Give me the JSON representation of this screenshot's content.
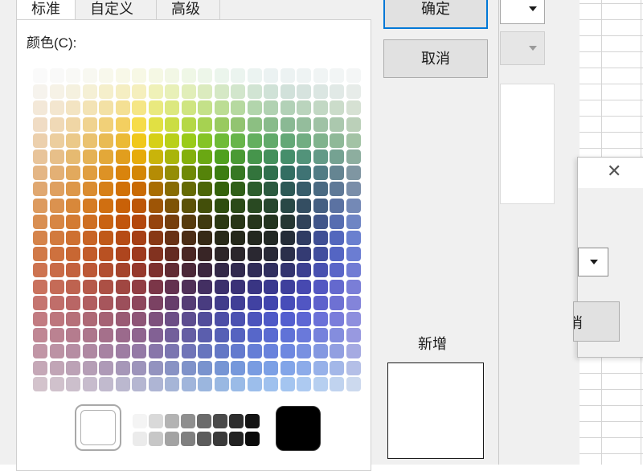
{
  "dialog": {
    "tabs": [
      {
        "label": "标准",
        "active": true
      },
      {
        "label": "自定义",
        "active": false
      },
      {
        "label": "高级",
        "active": false
      }
    ],
    "color_label": "颜色(C):",
    "ok_label": "确定",
    "cancel_label": "取消",
    "new_label": "新增",
    "current_color": "#ffffff",
    "new_color": "#ffffff"
  },
  "palette": {
    "grid_colors": [
      [
        "#fafafa",
        "#f9f9f8",
        "#f9f9f6",
        "#f8f8f1",
        "#f8f8ec",
        "#f8f8e8",
        "#f7f8e5",
        "#f5f8e4",
        "#f2f7e5",
        "#eff7e6",
        "#edf6e9",
        "#ebf5ec",
        "#ebf4ef",
        "#ebf3f1",
        "#ebf2f2",
        "#ecf2f2",
        "#eef3f3",
        "#f0f4f4",
        "#f2f5f5",
        "#f4f6f6"
      ],
      [
        "#f6f3ed",
        "#f6f2e6",
        "#f5f1df",
        "#f5f0d5",
        "#f5efcb",
        "#f5eec2",
        "#f5efbd",
        "#eff1b8",
        "#e8f0b8",
        "#e1eeb9",
        "#dbebbe",
        "#d5e8c5",
        "#d2e6cc",
        "#d1e4d3",
        "#d0e2d7",
        "#d1e1da",
        "#d6e3de",
        "#dbe6e2",
        "#e1e9e6",
        "#e7ece9"
      ],
      [
        "#f3e8d8",
        "#f3e6cf",
        "#f3e4c2",
        "#f3e3b5",
        "#f3e1a5",
        "#f4e094",
        "#f5e686",
        "#e9e97f",
        "#dce87f",
        "#cfe581",
        "#c4e189",
        "#bcdd94",
        "#b6d9a0",
        "#b2d5ac",
        "#b1d2b2",
        "#b2d1b7",
        "#bad4bd",
        "#c2d8c4",
        "#cbdcca",
        "#d6e1d3"
      ],
      [
        "#f0dcc4",
        "#f0d9b6",
        "#f0d6a5",
        "#f0d390",
        "#f1d078",
        "#f3cf60",
        "#f6dc4a",
        "#e1e043",
        "#cbdd43",
        "#b5d846",
        "#a6d251",
        "#99ca60",
        "#92c471",
        "#8cbf82",
        "#89bb8b",
        "#8ab994",
        "#94bd9c",
        "#9fc2a5",
        "#abc8ae",
        "#bbd0b9"
      ],
      [
        "#ecd0ad",
        "#ecce9e",
        "#ebc989",
        "#eac26f",
        "#e9bb53",
        "#ebba35",
        "#f0c81b",
        "#d6d016",
        "#b9d018",
        "#9acb1a",
        "#85c426",
        "#6fbb36",
        "#68b54a",
        "#64af5f",
        "#62aa6b",
        "#64a877",
        "#71ad82",
        "#80b38d",
        "#8fb998",
        "#a3c3a5"
      ],
      [
        "#e8c49a",
        "#e7bf89",
        "#e6ba71",
        "#e5b255",
        "#e3a839",
        "#e19e1e",
        "#e6ab0b",
        "#c9b40a",
        "#a9b50b",
        "#84b00c",
        "#6aa813",
        "#4fa01e",
        "#4a9a34",
        "#46954c",
        "#44905b",
        "#458e6b",
        "#52937a",
        "#639a87",
        "#75a292",
        "#8dae9f"
      ],
      [
        "#e4b685",
        "#e3b075",
        "#e2a95d",
        "#e09e40",
        "#dd9225",
        "#d9840d",
        "#d48706",
        "#b58c05",
        "#948d05",
        "#6f8906",
        "#55830a",
        "#3c7d11",
        "#377823",
        "#33743c",
        "#31704d",
        "#336e62",
        "#3f7374",
        "#517c85",
        "#658592",
        "#7f96a2"
      ],
      [
        "#e0a871",
        "#dfa060",
        "#dd9749",
        "#da8c30",
        "#d67f18",
        "#d17108",
        "#c96a04",
        "#a96d03",
        "#886c03",
        "#656a04",
        "#4c6607",
        "#34620c",
        "#305f19",
        "#2d5d2e",
        "#2b5a3f",
        "#2d5956",
        "#385d6b",
        "#4a6a82",
        "#5f7997",
        "#7a8ea9"
      ],
      [
        "#dd9b5f",
        "#db924f",
        "#d8883a",
        "#d57c24",
        "#d06f11",
        "#c96108",
        "#bd5607",
        "#9e5506",
        "#7e5306",
        "#5c5207",
        "#434f0a",
        "#2e4d0f",
        "#2b4a18",
        "#294922",
        "#27472e",
        "#294846",
        "#344e62",
        "#455f82",
        "#5b72a2",
        "#7489b6"
      ],
      [
        "#d98f52",
        "#d78644",
        "#d37b33",
        "#ce6f22",
        "#c96313",
        "#c1550d",
        "#b3480d",
        "#95440d",
        "#763f0d",
        "#573c0e",
        "#403a10",
        "#2c3913",
        "#283617",
        "#26351c",
        "#243520",
        "#263733",
        "#31435a",
        "#41568a",
        "#566db1",
        "#6e85c4"
      ],
      [
        "#d5844b",
        "#d27a3e",
        "#ce7031",
        "#c86425",
        "#c05919",
        "#b64c15",
        "#a63f15",
        "#883815",
        "#683115",
        "#4b2d15",
        "#362a16",
        "#282a18",
        "#25291b",
        "#23281f",
        "#222924",
        "#252d38",
        "#303c63",
        "#3f4f95",
        "#5367bd",
        "#6a80cf"
      ],
      [
        "#d17a49",
        "#ce713e",
        "#c86733",
        "#c25c2a",
        "#b95122",
        "#ae451e",
        "#9e3a1e",
        "#823220",
        "#642b22",
        "#4a2724",
        "#382526",
        "#2d2628",
        "#2b272c",
        "#2a2831",
        "#292a37",
        "#2b2f4b",
        "#343b73",
        "#414e9e",
        "#5465c3",
        "#6b7dd2"
      ],
      [
        "#cd7350",
        "#c96b47",
        "#c3623e",
        "#bc5836",
        "#b24e30",
        "#a5442c",
        "#96392c",
        "#7d312f",
        "#612b33",
        "#4b2838",
        "#3c273f",
        "#332847",
        "#312a4f",
        "#302c57",
        "#302f5f",
        "#333470",
        "#3c4091",
        "#4851b0",
        "#5a66c8",
        "#717cd4"
      ],
      [
        "#c9725e",
        "#c56b57",
        "#be6350",
        "#b6594a",
        "#ac5045",
        "#a04742",
        "#913d43",
        "#7b3648",
        "#63314f",
        "#503058",
        "#432f62",
        "#3b306c",
        "#3a3277",
        "#393583",
        "#3a398f",
        "#3e3f9c",
        "#4749b0",
        "#5357c2",
        "#6469ce",
        "#7a7ed7"
      ],
      [
        "#c57570",
        "#c06e6a",
        "#b96665",
        "#b15e60",
        "#a7565c",
        "#9c4f5b",
        "#8e475d",
        "#7b4263",
        "#663e6b",
        "#553d75",
        "#493c80",
        "#423d8b",
        "#413f96",
        "#4142a2",
        "#4246ae",
        "#474db9",
        "#5156c3",
        "#5e62cc",
        "#6e71d3",
        "#8384da"
      ],
      [
        "#c27c82",
        "#bd767d",
        "#b67079",
        "#ae6976",
        "#a56274",
        "#9a5b74",
        "#8e5577",
        "#7e517d",
        "#6c4e86",
        "#5d4d90",
        "#524d9b",
        "#4c4ea6",
        "#4b51b1",
        "#4c54bc",
        "#4e59c6",
        "#545fcf",
        "#5e67d4",
        "#6b71d8",
        "#7a7ddb",
        "#8e8fde"
      ],
      [
        "#c08794",
        "#bb8291",
        "#b57c8e",
        "#ad768c",
        "#a5708b",
        "#9b6a8c",
        "#8f658f",
        "#826194",
        "#725f9b",
        "#655ea4",
        "#5b5ead",
        "#5660b6",
        "#5663c0",
        "#5767c9",
        "#5a6bd1",
        "#6072d7",
        "#6a79da",
        "#7682dc",
        "#848dde",
        "#9899e0"
      ],
      [
        "#c196a6",
        "#bc92a4",
        "#b68da3",
        "#af88a2",
        "#a782a2",
        "#9e7da3",
        "#9479a6",
        "#8876aa",
        "#7b75b0",
        "#7074b7",
        "#6875be",
        "#6477c5",
        "#647ace",
        "#667ed6",
        "#6982dc",
        "#6f88e0",
        "#7990e1",
        "#8498e1",
        "#929fe1",
        "#a5aae2"
      ],
      [
        "#c5a8b7",
        "#c1a5b6",
        "#bca2b6",
        "#b59eb6",
        "#ae9ab7",
        "#a697b8",
        "#9d94bb",
        "#9393bf",
        "#8892c4",
        "#7f92c9",
        "#7993ce",
        "#7695d4",
        "#7698db",
        "#799ce1",
        "#7ca0e5",
        "#82a5e8",
        "#8cabe9",
        "#97b1e9",
        "#a3b7e8",
        "#b4bfe7"
      ],
      [
        "#d3c3cc",
        "#d0c1cc",
        "#ccbfcc",
        "#c7bccd",
        "#c1bace",
        "#bbb8cf",
        "#b5b6d1",
        "#aeb5d4",
        "#a6b5d7",
        "#a0b5db",
        "#9bb6de",
        "#99b8e2",
        "#9abbe7",
        "#9cbeeb",
        "#9fc1ee",
        "#a4c5f0",
        "#adcaf1",
        "#b6cff0",
        "#c0d3ef",
        "#ccd9ee"
      ]
    ],
    "gray_colors": [
      [
        "#f4f4f4",
        "#d9d9d9",
        "#b3b3b3",
        "#8f8f8f",
        "#6b6b6b",
        "#4a4a4a",
        "#2e2e2e",
        "#141414"
      ],
      [
        "#ebebeb",
        "#c7c7c7",
        "#a3a3a3",
        "#808080",
        "#5c5c5c",
        "#3a3a3a",
        "#222222",
        "#0a0a0a"
      ]
    ]
  }
}
